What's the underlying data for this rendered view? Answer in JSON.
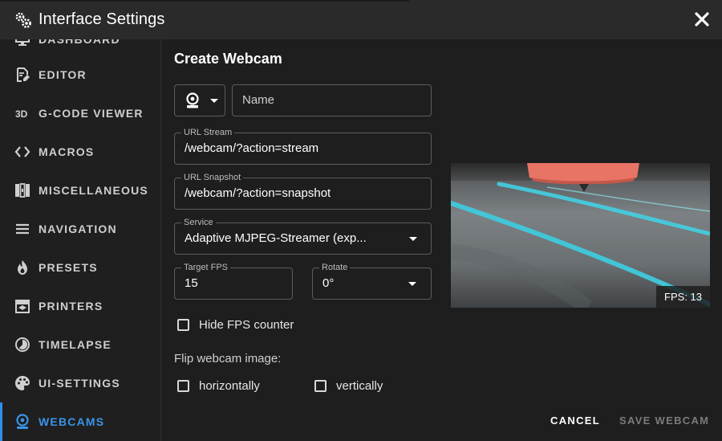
{
  "window": {
    "title": "Interface Settings",
    "close_icon": "close-icon"
  },
  "sidebar": {
    "items": [
      {
        "label": "Dashboard",
        "icon": "dashboard-icon",
        "active": false
      },
      {
        "label": "Editor",
        "icon": "file-edit-icon",
        "active": false
      },
      {
        "label": "G-Code Viewer",
        "icon": "3d-icon",
        "active": false
      },
      {
        "label": "Macros",
        "icon": "code-brackets-icon",
        "active": false
      },
      {
        "label": "Miscellaneous",
        "icon": "blocks-icon",
        "active": false
      },
      {
        "label": "Navigation",
        "icon": "menu-icon",
        "active": false
      },
      {
        "label": "Presets",
        "icon": "fire-icon",
        "active": false
      },
      {
        "label": "Printers",
        "icon": "printer-3d-icon",
        "active": false
      },
      {
        "label": "Timelapse",
        "icon": "timelapse-icon",
        "active": false
      },
      {
        "label": "UI-Settings",
        "icon": "palette-icon",
        "active": false
      },
      {
        "label": "Webcams",
        "icon": "webcam-icon",
        "active": true
      }
    ],
    "active_color": "#3b93e8"
  },
  "form": {
    "title": "Create Webcam",
    "icon_select": {
      "icon": "webcam-icon"
    },
    "name": {
      "placeholder": "Name",
      "value": ""
    },
    "url_stream": {
      "label": "URL Stream",
      "value": "/webcam/?action=stream"
    },
    "url_snapshot": {
      "label": "URL Snapshot",
      "value": "/webcam/?action=snapshot"
    },
    "service": {
      "label": "Service",
      "value": "Adaptive MJPEG-Streamer (exp..."
    },
    "target_fps": {
      "label": "Target FPS",
      "value": "15"
    },
    "rotate": {
      "label": "Rotate",
      "value": "0°"
    },
    "hide_fps": {
      "label": "Hide FPS counter",
      "checked": false
    },
    "flip": {
      "label": "Flip webcam image:",
      "horizontally": {
        "label": "horizontally",
        "checked": false
      },
      "vertically": {
        "label": "vertically",
        "checked": false
      }
    }
  },
  "preview": {
    "fps_label": "FPS: 13"
  },
  "actions": {
    "cancel": "CANCEL",
    "save": "SAVE WEBCAM"
  }
}
